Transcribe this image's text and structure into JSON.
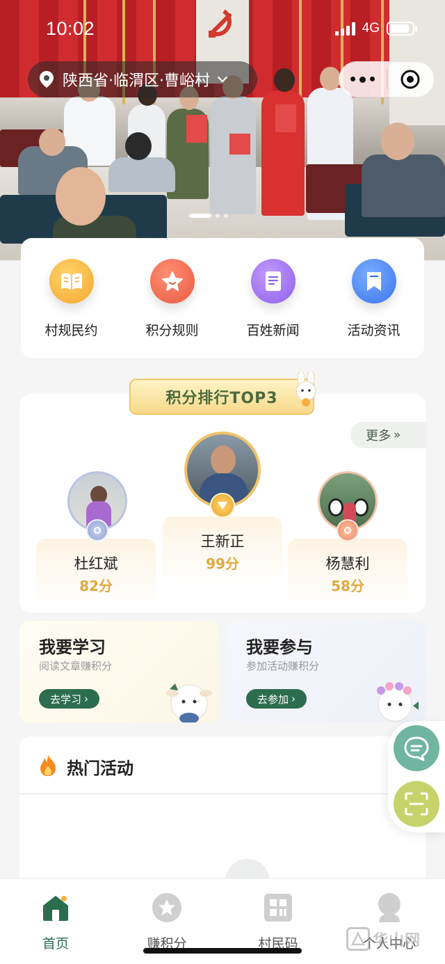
{
  "status": {
    "time": "10:02",
    "network": "4G"
  },
  "header": {
    "location": "陕西省·临渭区·曹峪村"
  },
  "quick_menu": [
    {
      "label": "村规民约",
      "icon": "book-icon",
      "color": "#f5b73a"
    },
    {
      "label": "积分规则",
      "icon": "star-icon",
      "color": "#ef6a4f"
    },
    {
      "label": "百姓新闻",
      "icon": "document-icon",
      "color": "#9a6cf0"
    },
    {
      "label": "活动资讯",
      "icon": "bookmark-icon",
      "color": "#3e7ff0"
    }
  ],
  "ranking": {
    "title": "积分排行TOP3",
    "more_label": "更多",
    "first": {
      "name": "王新正",
      "score": "99分",
      "rank": 1
    },
    "second": {
      "name": "杜红斌",
      "score": "82分",
      "rank": 2
    },
    "third": {
      "name": "杨慧利",
      "score": "58分",
      "rank": 3
    }
  },
  "tasks": {
    "study": {
      "title": "我要学习",
      "subtitle": "阅读文章赚积分",
      "button": "去学习"
    },
    "join": {
      "title": "我要参与",
      "subtitle": "参加活动赚积分",
      "button": "去参加"
    }
  },
  "hot": {
    "title": "热门活动"
  },
  "tabs": [
    {
      "label": "首页",
      "icon": "home-icon",
      "active": true
    },
    {
      "label": "赚积分",
      "icon": "star-circle-icon",
      "active": false
    },
    {
      "label": "村民码",
      "icon": "qr-code-icon",
      "active": false
    },
    {
      "label": "个人中心",
      "icon": "user-icon",
      "active": false
    }
  ],
  "colors": {
    "brand_green": "#2c6d4e",
    "score_gold": "#e0a940"
  },
  "watermark": "华山网"
}
